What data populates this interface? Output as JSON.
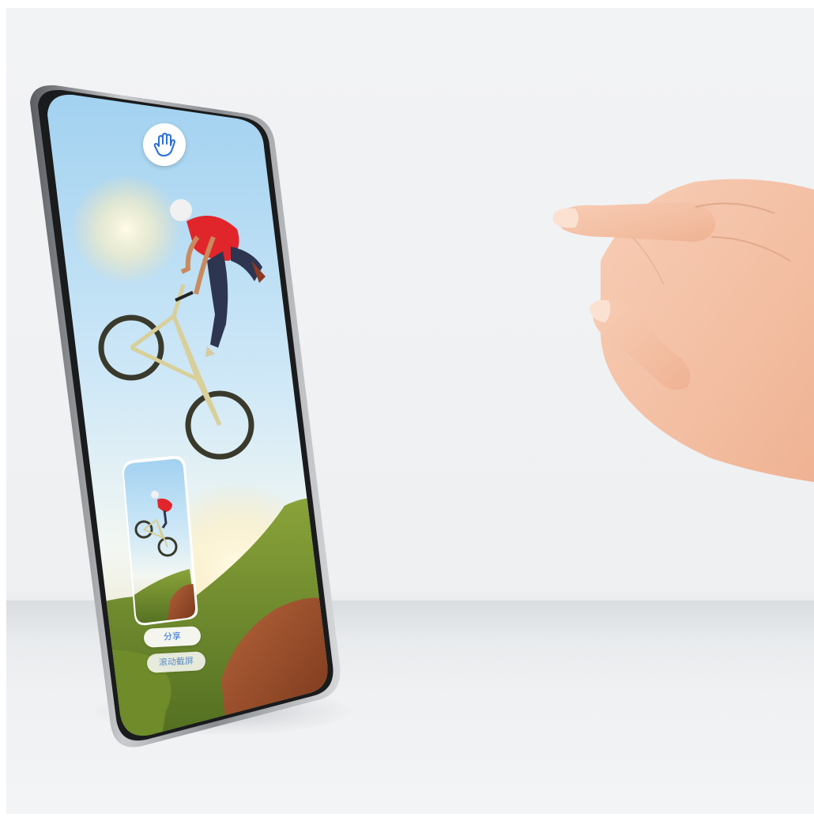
{
  "scene": {
    "description_free": true
  },
  "phone": {
    "gesture_icon": "hand-palm-icon",
    "thumbnail": {
      "actions": [
        {
          "label": "分享",
          "icon": "share"
        },
        {
          "label": "滚动截屏",
          "icon": "scroll-screenshot"
        }
      ]
    }
  },
  "colors": {
    "accent": "#2b6fd6",
    "sky_top": "#a9d6f2",
    "sky_bottom": "#e9f4fb",
    "skin": "#f4c3a8",
    "background": "#f2f3f5"
  }
}
